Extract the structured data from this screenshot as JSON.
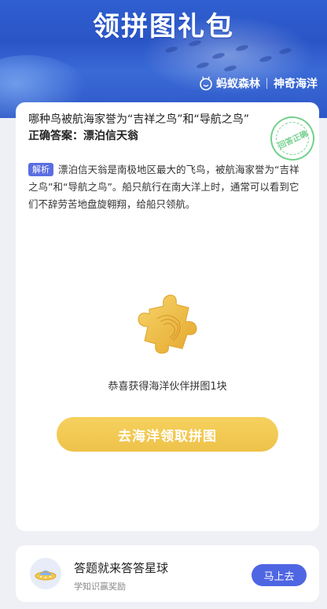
{
  "banner": {
    "title": "领拼图礼包",
    "brand_primary": "蚂蚁森林",
    "brand_secondary": "神奇海洋"
  },
  "quiz": {
    "question": "哪种鸟被航海家誉为“吉祥之鸟”和“导航之鸟”",
    "answer_prefix": "正确答案：",
    "answer_value": "漂泊信天翁",
    "stamp_text": "回答正确",
    "analysis_tag": "解析",
    "analysis_text": "漂泊信天翁是南极地区最大的飞鸟，被航海家誉为“吉祥之鸟”和“导航之鸟”。船只航行在南大洋上时，通常可以看到它们不辞劳苦地盘旋翱翔，给船只领航。"
  },
  "reward": {
    "message": "恭喜获得海洋伙伴拼图1块",
    "button_label": "去海洋领取拼图",
    "icon": "puzzle-piece-icon"
  },
  "promo": {
    "title": "答题就来答答星球",
    "subtitle": "学知识赢奖励",
    "button_label": "马上去",
    "icon": "planet-ufo-icon"
  },
  "colors": {
    "banner_blue": "#2f5fd0",
    "cta_yellow": "#f0c54d",
    "accent_blue": "#4f66e3",
    "stamp_green": "#5cc87a",
    "page_bg": "#eef0f6"
  }
}
